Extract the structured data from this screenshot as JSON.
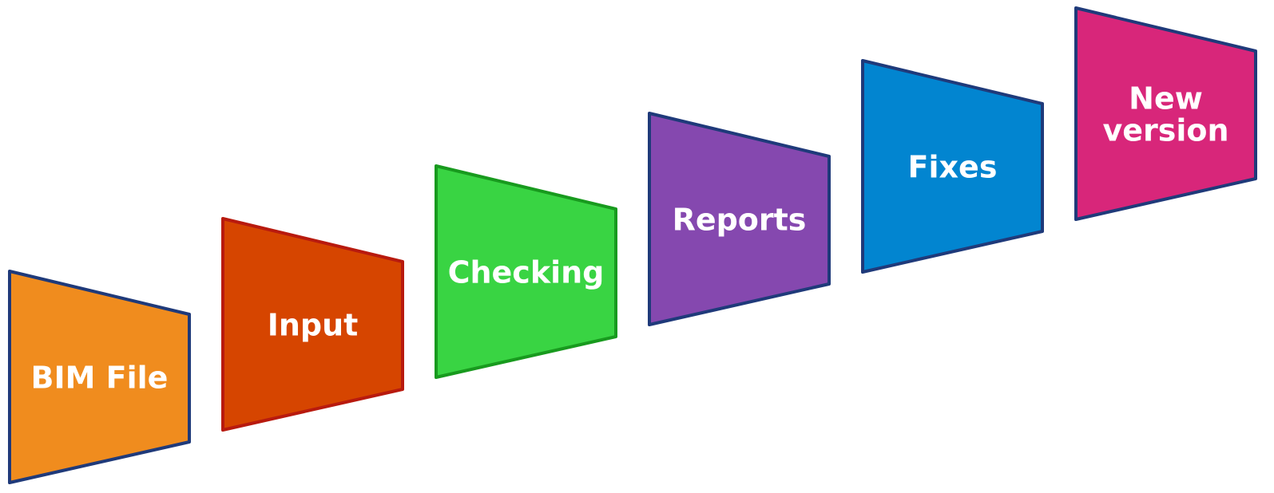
{
  "diagram": {
    "steps": [
      {
        "label_lines": [
          "BIM File"
        ],
        "fill": "#F08C1E",
        "stroke": "#1F3A7A"
      },
      {
        "label_lines": [
          "Input"
        ],
        "fill": "#D64500",
        "stroke": "#B81A0E"
      },
      {
        "label_lines": [
          "Checking"
        ],
        "fill": "#39D443",
        "stroke": "#189A1E"
      },
      {
        "label_lines": [
          "Reports"
        ],
        "fill": "#8548AF",
        "stroke": "#1F3A7A"
      },
      {
        "label_lines": [
          "Fixes"
        ],
        "fill": "#0285D0",
        "stroke": "#1F3A7A"
      },
      {
        "label_lines": [
          "New",
          "version"
        ],
        "fill": "#D8267A",
        "stroke": "#1F3A7A"
      }
    ]
  }
}
